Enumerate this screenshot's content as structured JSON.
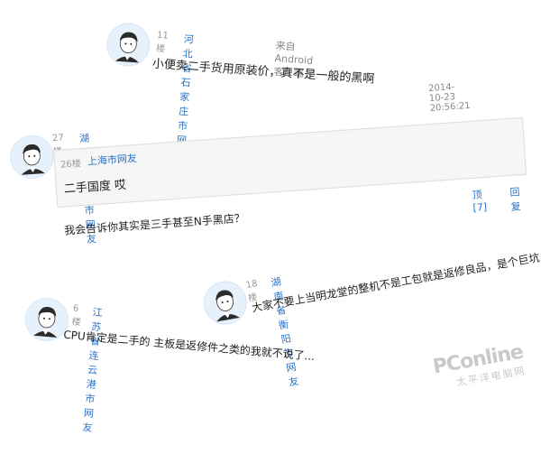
{
  "comments": [
    {
      "floor": "11楼",
      "user": "河北省石家庄市网友",
      "source": "来自 Android客户端",
      "text": "小便卖二手货用原装价，真不是一般的黑啊"
    },
    {
      "timestamp": "2014-10-23 20:56:21",
      "floor": "27楼",
      "user": "湖北省荆门市网友",
      "quote": {
        "floor": "26楼",
        "user": "上海市网友",
        "text": "二手国度 哎"
      },
      "text": "我会告诉你其实是三手甚至N手黑店？",
      "actions": {
        "up": "顶[7]",
        "reply": "回复"
      }
    },
    {
      "floor": "18楼",
      "user": "湖南省衡阳市网友",
      "text": "大家不要上当明龙堂的整机不是工包就是返修良品，是个巨坑"
    },
    {
      "floor": "6楼",
      "user": "江苏省连云港市网友",
      "text": "CPU肯定是二手的  主板是返修件之类的我就不说了..."
    }
  ],
  "watermark": {
    "logo": "PConline",
    "sub": "太平洋电脑网"
  },
  "colors": {
    "link": "#2a73c9",
    "avatar_bg": "#e6f1fb"
  }
}
